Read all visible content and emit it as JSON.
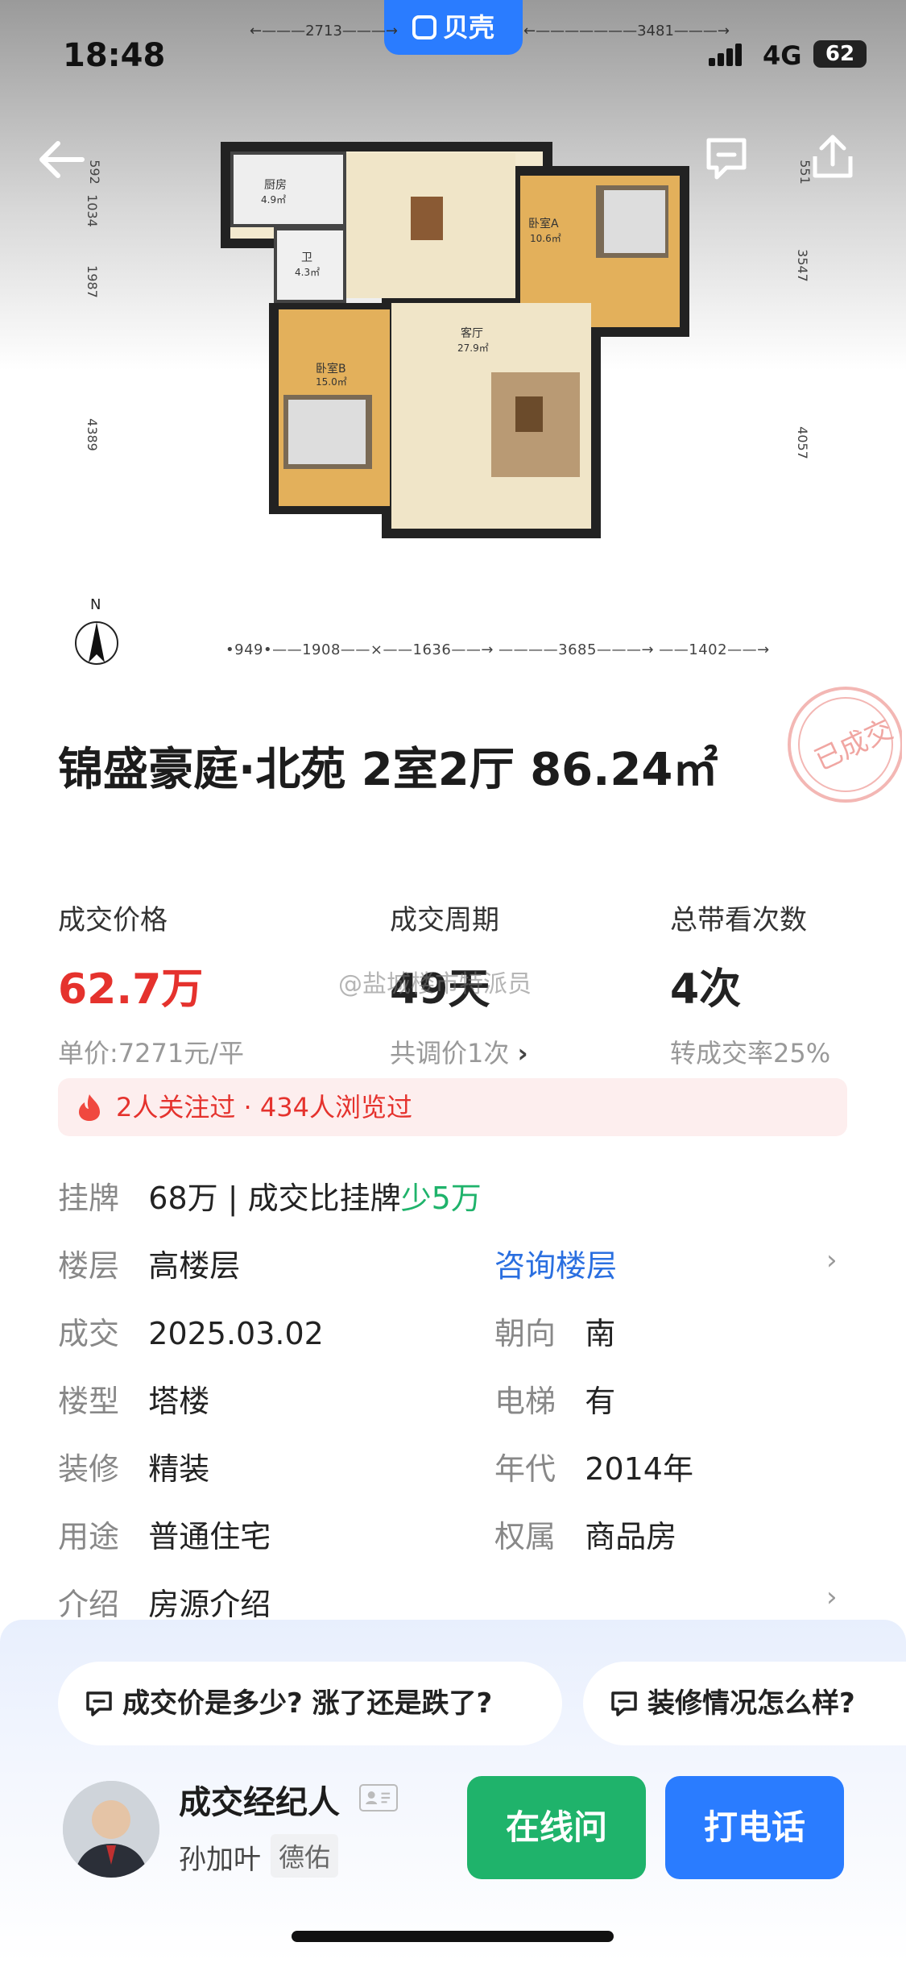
{
  "status_bar": {
    "time": "18:48",
    "network": "4G",
    "battery": "62"
  },
  "app": {
    "brand": "贝壳"
  },
  "floorplan": {
    "top_dims": [
      "2713",
      "3481"
    ],
    "left_dims": [
      "592",
      "1034",
      "1987",
      "4389"
    ],
    "right_dims": [
      "551",
      "3547",
      "4057"
    ],
    "bottom_dims": [
      "949",
      "1908",
      "1636",
      "3685",
      "1402"
    ],
    "rooms": {
      "kitchen": "厨房",
      "kitchen_area": "4.9㎡",
      "bath": "卫",
      "bath_area": "4.3㎡",
      "bedroom_a": "卧室A",
      "bedroom_a_area": "10.6㎡",
      "living": "客厅",
      "living_area": "27.9㎡",
      "bedroom_b": "卧室B",
      "bedroom_b_area": "15.0㎡"
    },
    "compass": "N"
  },
  "listing": {
    "stamp": "已成交",
    "title": "锦盛豪庭·北苑 2室2厅 86.24㎡",
    "stats": [
      {
        "label": "成交价格",
        "value": "62.7万",
        "sub": "单价:7271元/平"
      },
      {
        "label": "成交周期",
        "value": "49天",
        "sub": "共调价1次",
        "sub_arrow": "›"
      },
      {
        "label": "总带看次数",
        "value": "4次",
        "sub": "转成交率25%"
      }
    ],
    "watermark": "@盐城楼市特派员",
    "hot": "2人关注过 · 434人浏览过",
    "listed": {
      "key": "挂牌",
      "value": "68万 | 成交比挂牌",
      "diff": "少5万"
    },
    "floor": {
      "key": "楼层",
      "value": "高楼层",
      "action": "咨询楼层"
    },
    "deal": {
      "key": "成交",
      "value": "2025.03.02"
    },
    "orientation": {
      "key": "朝向",
      "value": "南"
    },
    "building": {
      "key": "楼型",
      "value": "塔楼"
    },
    "elevator": {
      "key": "电梯",
      "value": "有"
    },
    "decoration": {
      "key": "装修",
      "value": "精装"
    },
    "year": {
      "key": "年代",
      "value": "2014年"
    },
    "usage": {
      "key": "用途",
      "value": "普通住宅"
    },
    "ownership": {
      "key": "权属",
      "value": "商品房"
    },
    "intro": {
      "key": "介绍",
      "value": "房源介绍"
    }
  },
  "questions": [
    "成交价是多少? 涨了还是跌了?",
    "装修情况怎么样?"
  ],
  "agent": {
    "title": "成交经纪人",
    "name": "孙加叶",
    "brand": "德佑"
  },
  "actions": {
    "online": "在线问",
    "call": "打电话"
  },
  "colors": {
    "accent_blue": "#2a7cff",
    "price_red": "#e5322d",
    "green": "#1fb36b"
  }
}
